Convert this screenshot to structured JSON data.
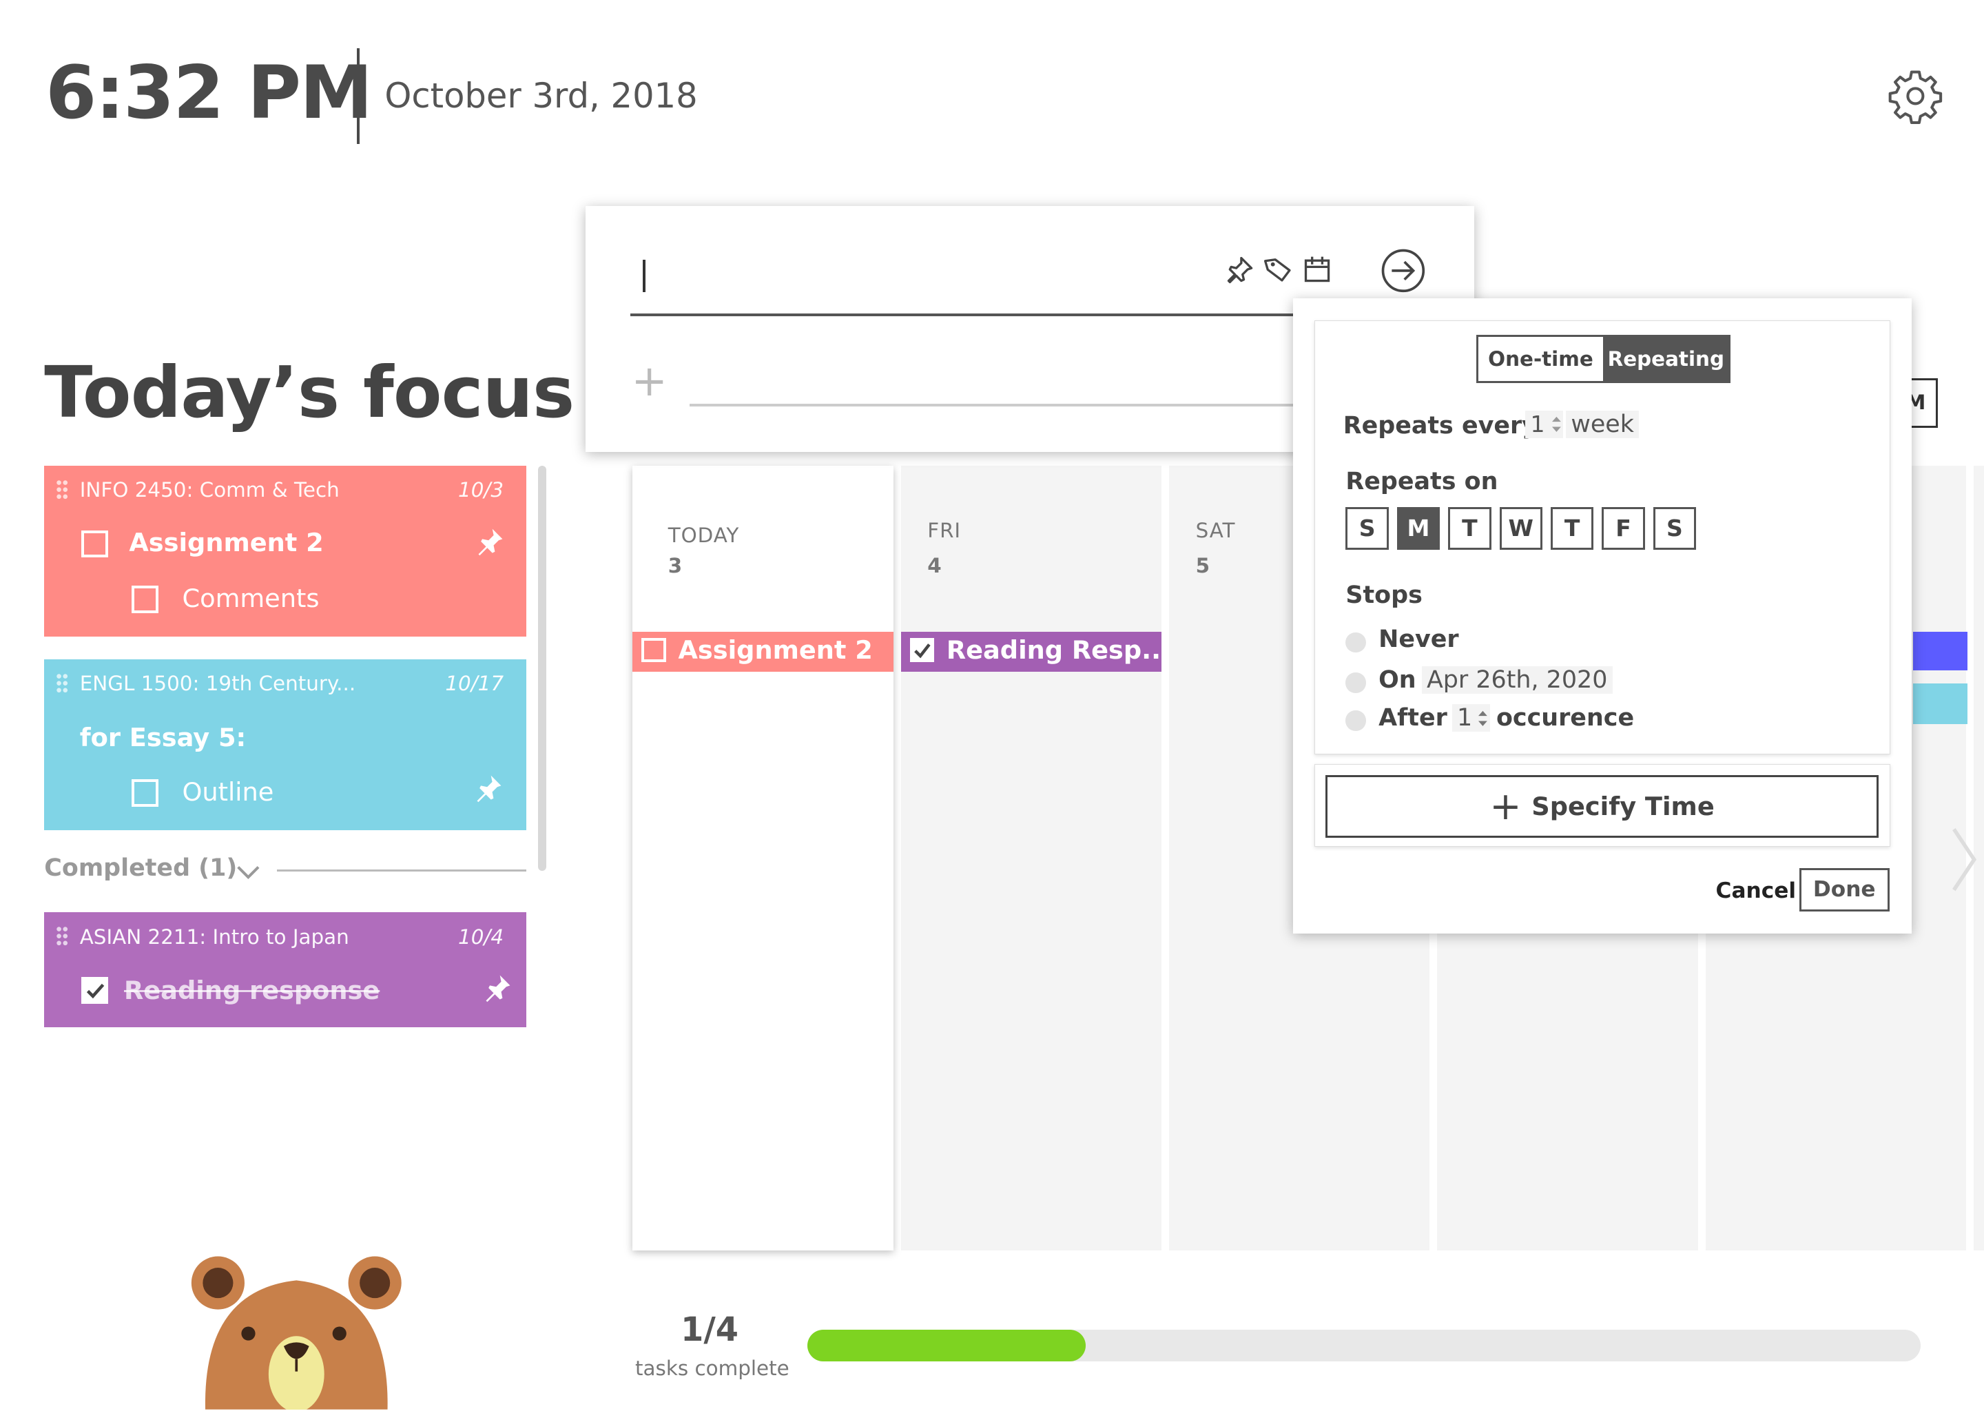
{
  "header": {
    "time": "6:32 PM",
    "date": "October 3rd, 2018",
    "settings_icon": "gear-icon"
  },
  "focus": {
    "title": "Today’s focus",
    "cards": [
      {
        "course": "INFO 2450: Comm & Tech",
        "due": "10/3",
        "color": "#ff8a85",
        "task": "Assignment 2",
        "subtask": "Comments",
        "pinned": true
      },
      {
        "course": "ENGL 1500: 19th Century...",
        "due": "10/17",
        "color": "#80d4e6",
        "task": "for Essay 5:",
        "subtask": "Outline",
        "pinned": true
      }
    ],
    "completed_label": "Completed (1)",
    "completed_cards": [
      {
        "course": "ASIAN 2211: Intro to Japan",
        "due": "10/4",
        "color": "#b06dbc",
        "task": "Reading response",
        "checked": true,
        "pinned": true
      }
    ]
  },
  "calendar": {
    "columns": [
      {
        "day": "TODAY",
        "num": "3"
      },
      {
        "day": "FRI",
        "num": "4"
      },
      {
        "day": "SAT",
        "num": "5"
      }
    ],
    "events": [
      {
        "label": "Assignment 2",
        "color": "#ff8a85",
        "checked": false
      },
      {
        "label": "Reading Resp...",
        "color": "#a35fb3",
        "checked": true
      }
    ],
    "view_toggle_visible": "M"
  },
  "progress": {
    "fraction": "1/4",
    "label": "tasks complete",
    "value": 0.25,
    "color": "#7ed321"
  },
  "input_panel": {
    "icons": [
      "pin-icon",
      "tag-icon",
      "calendar-icon",
      "submit-arrow-icon"
    ]
  },
  "repeat_popup": {
    "mode_options": [
      "One-time",
      "Repeating"
    ],
    "selected_mode": "Repeating",
    "repeats_every_label": "Repeats every",
    "interval": "1",
    "unit": "week",
    "repeats_on_label": "Repeats on",
    "days": [
      "S",
      "M",
      "T",
      "W",
      "T",
      "F",
      "S"
    ],
    "selected_day_index": 1,
    "stops_label": "Stops",
    "stop_options": {
      "never": "Never",
      "on": "On",
      "on_date": "Apr 26th, 2020",
      "after": "After",
      "after_count": "1",
      "after_unit": "occurence"
    },
    "specify_time": "Specify Time",
    "cancel": "Cancel",
    "done": "Done"
  }
}
